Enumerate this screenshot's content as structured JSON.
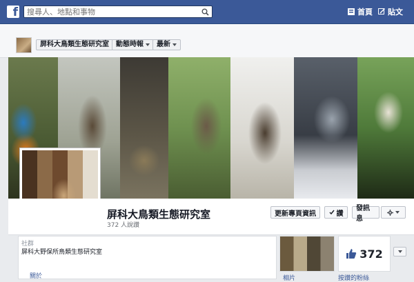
{
  "topbar": {
    "logo_letter": "f",
    "search_placeholder": "搜尋人、地點和事物",
    "home_label": "首頁",
    "post_label": "貼文"
  },
  "subheader": {
    "page_name": "屏科大鳥類生態研究室",
    "timeline_label": "動態時報",
    "latest_label": "最新"
  },
  "page": {
    "title": "屏科大鳥類生態研究室",
    "likes_text": "372 人說讚",
    "update_info_label": "更新專頁資訊",
    "like_label": "讚",
    "message_label": "發訊息"
  },
  "about": {
    "category": "社群",
    "description": "屏科大野保所鳥類生態研究室",
    "about_link": "關於",
    "photos_label": "相片",
    "likes_label": "按讚的粉絲",
    "like_count": "372"
  },
  "colors": {
    "brand": "#3b5998",
    "background": "#e9ebee"
  },
  "icons": {
    "search": "search-icon",
    "home": "home-icon",
    "post": "edit-icon",
    "check": "check-icon",
    "gear": "gear-icon",
    "thumb": "thumbs-up-icon",
    "caret": "chevron-down-icon"
  }
}
